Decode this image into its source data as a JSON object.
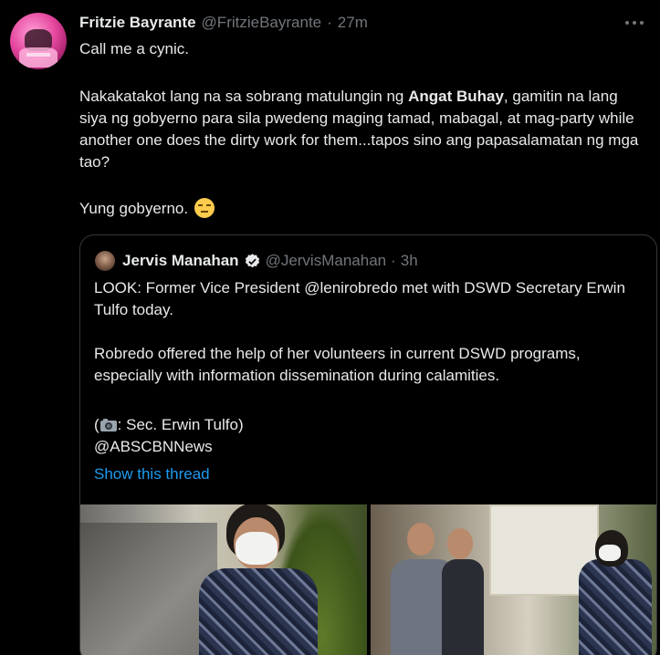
{
  "tweet": {
    "author_name": "Fritzie Bayrante",
    "author_handle": "@FritzieBayrante",
    "separator": "·",
    "time": "27m",
    "line1": "Call me a cynic.",
    "para_before_bold": "Nakakatakot lang na sa sobrang matulungin ng ",
    "para_bold": "Angat Buhay",
    "para_after_bold": ", gamitin na lang siya ng gobyerno para sila pwedeng maging tamad, mabagal, at mag-party while another one does the dirty work for them...tapos sino ang papasalamatan ng mga tao?",
    "closing": "Yung gobyerno.",
    "closing_emoji": "unamused-face-emoji",
    "more_icon": "more-horizontal-icon"
  },
  "quoted_tweet": {
    "author_name": "Jervis Manahan",
    "author_handle": "@JervisManahan",
    "separator": "·",
    "time": "3h",
    "verified_icon": "verified-badge-icon",
    "line1": "LOOK: Former Vice President @lenirobredo met with DSWD Secretary Erwin Tulfo today.",
    "line2": "Robredo offered the help of her volunteers in current DSWD programs, especially with information dissemination during calamities.",
    "credit_open": "(",
    "credit_icon": "camera-emoji",
    "credit_text": ": Sec. Erwin Tulfo)",
    "mention": "@ABSCBNNews",
    "show_thread": "Show this thread",
    "accent_color": "#1d9bf0"
  },
  "colors": {
    "background": "#000000",
    "text_primary": "#e7e9ea",
    "text_secondary": "#71767b",
    "border": "#333639",
    "link": "#1d9bf0"
  }
}
